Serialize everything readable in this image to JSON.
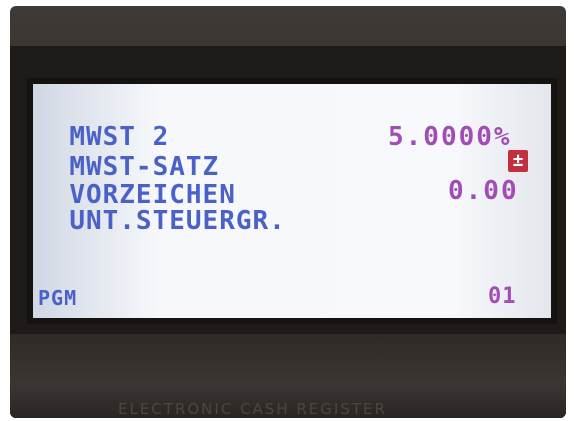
{
  "display": {
    "rows": [
      {
        "label": "MWST 2",
        "value": ""
      },
      {
        "label": "MWST-SATZ",
        "value": "5.0000%"
      },
      {
        "label": "VORZEICHEN",
        "value": "±"
      },
      {
        "label": "UNT.STEUERGR.",
        "value": "0.00"
      }
    ],
    "mode": "PGM",
    "page": "01"
  },
  "device": {
    "label": "ELECTRONIC CASH REGISTER"
  },
  "colors": {
    "label": "#4a62c8",
    "value": "#a24db5",
    "sign": "#c22f3f",
    "screen": "#f6f8fb",
    "bezel": "#2d2926"
  }
}
